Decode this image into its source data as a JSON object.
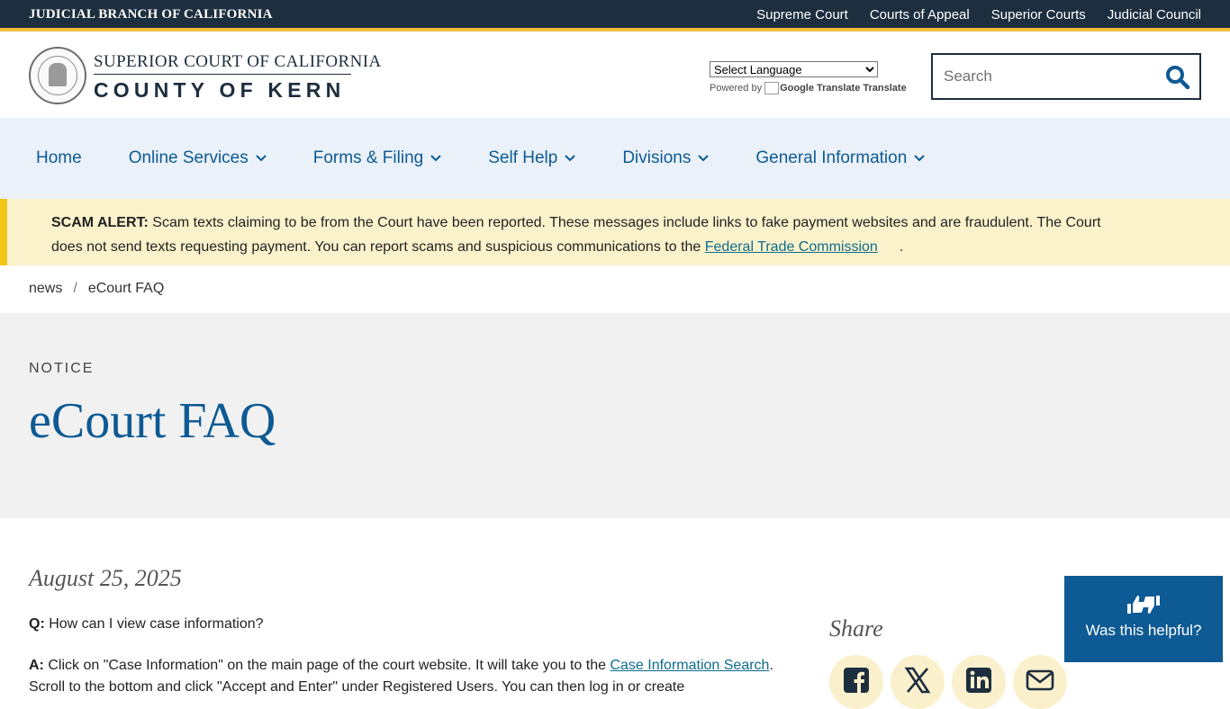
{
  "topbar": {
    "branch": "JUDICIAL BRANCH OF CALIFORNIA",
    "links": [
      "Supreme Court",
      "Courts of Appeal",
      "Superior Courts",
      "Judicial Council"
    ]
  },
  "logo": {
    "line1": "SUPERIOR COURT OF CALIFORNIA",
    "line2": "COUNTY OF KERN"
  },
  "translate": {
    "select_value": "Select Language",
    "powered_by": "Powered by",
    "google_translate": "Google Translate",
    "translate": "Translate"
  },
  "search": {
    "placeholder": "Search"
  },
  "nav": {
    "items": [
      {
        "label": "Home"
      },
      {
        "label": "Online Services"
      },
      {
        "label": "Forms & Filing"
      },
      {
        "label": "Self Help"
      },
      {
        "label": "Divisions"
      },
      {
        "label": "General Information"
      }
    ]
  },
  "alert": {
    "label": "SCAM ALERT:",
    "text": " Scam texts claiming to be from the Court have been reported. These messages include links to fake payment websites and are fraudulent. The Court does not send texts requesting payment. You can report scams and suspicious communications to the ",
    "link": "Federal Trade Commission",
    "end": "."
  },
  "breadcrumb": {
    "items": [
      "news",
      "eCourt FAQ"
    ],
    "separator": "/"
  },
  "hero": {
    "kicker": "NOTICE",
    "title": "eCourt FAQ"
  },
  "article": {
    "date": "August 25, 2025",
    "q1_label": "Q:",
    "q1_text": " How can I view case information?",
    "a1_label": "A:",
    "a1_text": " Click on \"Case Information\" on the main page of the court website. It will take you to the ",
    "a1_link": "Case Information Search",
    "a1_tail": ". Scroll to the bottom and click \"Accept and Enter\" under Registered Users. You can then log in or create"
  },
  "share": {
    "title": "Share",
    "icons": [
      "facebook-icon",
      "x-icon",
      "linkedin-icon",
      "email-icon"
    ]
  },
  "helpful": {
    "label": "Was this helpful?"
  },
  "colors": {
    "topbar": "#1d2e3f",
    "accent_gold": "#f2bd3c",
    "nav_bg": "#eaf1f9",
    "link_blue": "#0e5a94",
    "alert_bg": "#fbf2cc"
  }
}
